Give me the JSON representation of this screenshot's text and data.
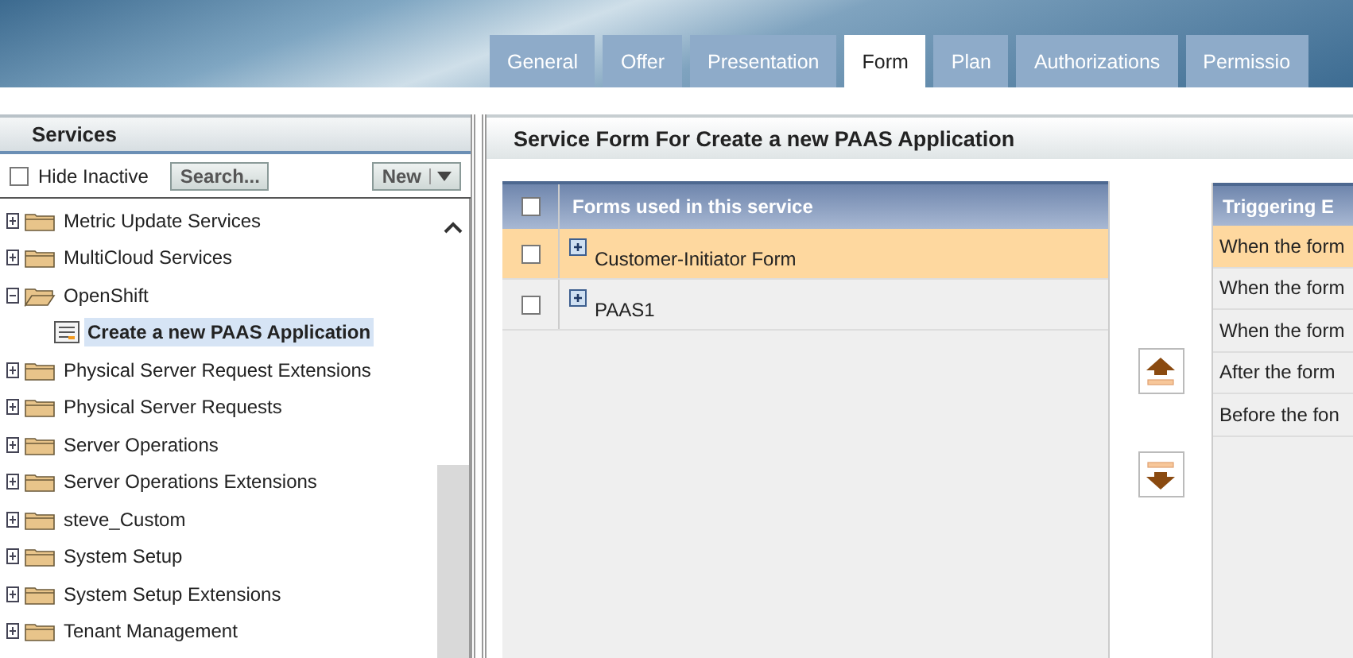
{
  "tabs": [
    {
      "label": "General",
      "selected": false
    },
    {
      "label": "Offer",
      "selected": false
    },
    {
      "label": "Presentation",
      "selected": false
    },
    {
      "label": "Form",
      "selected": true
    },
    {
      "label": "Plan",
      "selected": false
    },
    {
      "label": "Authorizations",
      "selected": false
    },
    {
      "label": "Permissio",
      "selected": false
    }
  ],
  "sidebar": {
    "title": "Services",
    "hide_inactive": {
      "label": "Hide Inactive",
      "checked": false
    },
    "search_button": "Search...",
    "new_button": "New",
    "tree": [
      {
        "label": "Metric Update Services",
        "expanded": false,
        "selected": false
      },
      {
        "label": "MultiCloud Services",
        "expanded": false,
        "selected": false
      },
      {
        "label": "OpenShift",
        "expanded": true,
        "selected": false,
        "children": [
          {
            "label": "Create a new PAAS Application",
            "selected": true
          }
        ]
      },
      {
        "label": "Physical Server Request Extensions",
        "expanded": false,
        "selected": false
      },
      {
        "label": "Physical Server Requests",
        "expanded": false,
        "selected": false
      },
      {
        "label": "Server Operations",
        "expanded": false,
        "selected": false
      },
      {
        "label": "Server Operations Extensions",
        "expanded": false,
        "selected": false
      },
      {
        "label": "steve_Custom",
        "expanded": false,
        "selected": false
      },
      {
        "label": "System Setup",
        "expanded": false,
        "selected": false
      },
      {
        "label": "System Setup Extensions",
        "expanded": false,
        "selected": false
      },
      {
        "label": "Tenant Management",
        "expanded": false,
        "selected": false
      }
    ]
  },
  "main": {
    "title": "Service Form For Create a new PAAS Application",
    "forms_table": {
      "header": "Forms used in this service",
      "header_checked": false,
      "rows": [
        {
          "label": "Customer-Initiator Form",
          "checked": false,
          "selected": true
        },
        {
          "label": "PAAS1",
          "checked": false,
          "selected": false
        }
      ]
    },
    "triggers_table": {
      "header": "Triggering E",
      "rows": [
        {
          "label": "When the form",
          "selected": true
        },
        {
          "label": "When the form",
          "selected": false
        },
        {
          "label": "When the form",
          "selected": false
        },
        {
          "label": "After the form",
          "selected": false
        },
        {
          "label": "Before the fon",
          "selected": false
        }
      ]
    }
  }
}
